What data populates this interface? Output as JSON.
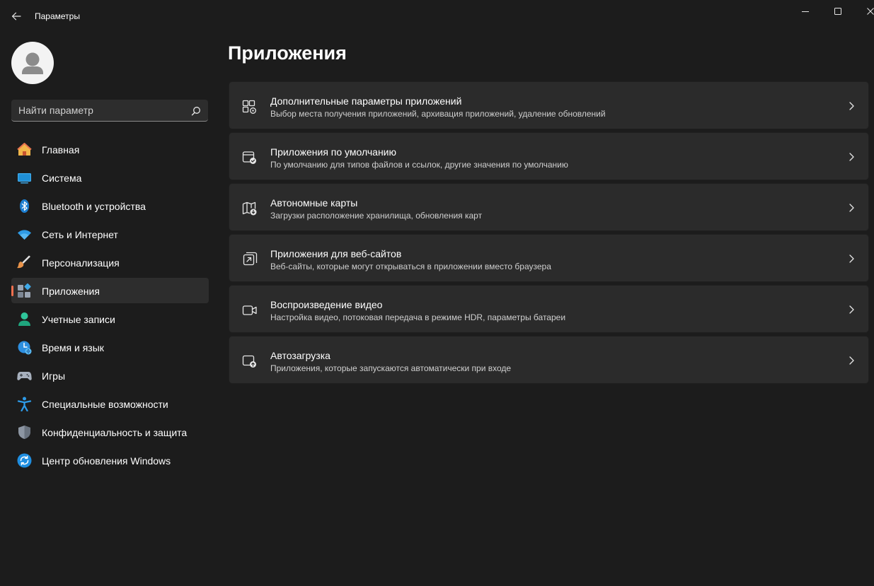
{
  "window": {
    "title": "Параметры"
  },
  "search": {
    "placeholder": "Найти параметр"
  },
  "sidebar": {
    "items": [
      {
        "label": "Главная",
        "icon": "home-icon"
      },
      {
        "label": "Система",
        "icon": "system-icon"
      },
      {
        "label": "Bluetooth и устройства",
        "icon": "bluetooth-icon"
      },
      {
        "label": "Сеть и Интернет",
        "icon": "wifi-icon"
      },
      {
        "label": "Персонализация",
        "icon": "brush-icon"
      },
      {
        "label": "Приложения",
        "icon": "apps-icon",
        "selected": true
      },
      {
        "label": "Учетные записи",
        "icon": "account-icon"
      },
      {
        "label": "Время и язык",
        "icon": "time-language-icon"
      },
      {
        "label": "Игры",
        "icon": "gamepad-icon"
      },
      {
        "label": "Специальные возможности",
        "icon": "accessibility-icon"
      },
      {
        "label": "Конфиденциальность и защита",
        "icon": "shield-icon"
      },
      {
        "label": "Центр обновления Windows",
        "icon": "update-icon"
      }
    ]
  },
  "main": {
    "title": "Приложения",
    "cards": [
      {
        "title": "Дополнительные параметры приложений",
        "description": "Выбор места получения приложений, архивация приложений, удаление обновлений",
        "icon": "advanced-app-settings-icon"
      },
      {
        "title": "Приложения по умолчанию",
        "description": "По умолчанию для типов файлов и ссылок, другие значения по умолчанию",
        "icon": "default-apps-icon"
      },
      {
        "title": "Автономные карты",
        "description": "Загрузки расположение хранилища, обновления карт",
        "icon": "offline-maps-icon"
      },
      {
        "title": "Приложения для веб-сайтов",
        "description": "Веб-сайты, которые могут открываться в приложении вместо браузера",
        "icon": "apps-for-websites-icon"
      },
      {
        "title": "Воспроизведение видео",
        "description": "Настройка видео, потоковая передача в режиме HDR, параметры батареи",
        "icon": "video-camera-icon"
      },
      {
        "title": "Автозагрузка",
        "description": "Приложения, которые запускаются автоматически при входе",
        "icon": "startup-icon"
      }
    ]
  },
  "colors": {
    "background": "#1c1c1c",
    "card": "#2b2b2b",
    "accent": "#f0704f",
    "selected": "#2d2d2d"
  }
}
